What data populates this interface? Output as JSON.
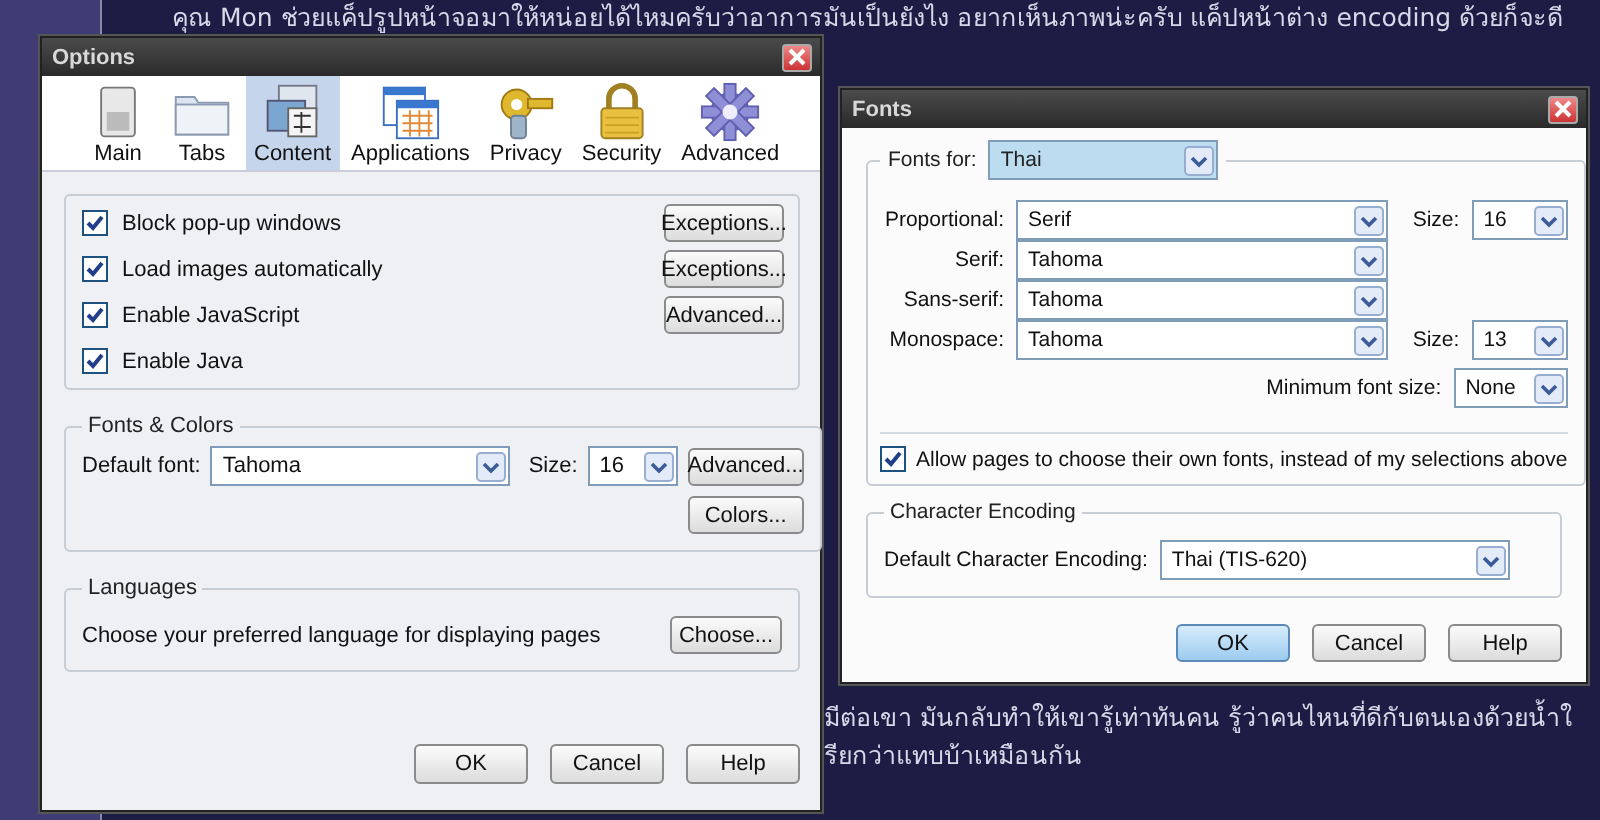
{
  "page_text": {
    "top_line": "คุณ Mon ช่วยแค็ปรูปหน้าจอมาให้หน่อยได้ไหมครับว่าอาการมันเป็นยังไง อยากเห็นภาพน่ะครับ แค็ปหน้าต่าง encoding ด้วยก็จะดี",
    "bottom_lines": [
      "มีต่อเขา มันกลับทำให้เขารู้เท่าทันคน รู้ว่าคนไหนที่ดีกับตนเองด้วยน้ำใ",
      "รียกว่าแทบบ้าเหมือนกัน"
    ]
  },
  "options_window": {
    "title": "Options",
    "tabs": [
      {
        "label": "Main",
        "selected": false
      },
      {
        "label": "Tabs",
        "selected": false
      },
      {
        "label": "Content",
        "selected": true
      },
      {
        "label": "Applications",
        "selected": false
      },
      {
        "label": "Privacy",
        "selected": false
      },
      {
        "label": "Security",
        "selected": false
      },
      {
        "label": "Advanced",
        "selected": false
      }
    ],
    "content_options": [
      {
        "label": "Block pop-up windows",
        "checked": true,
        "button": "Exceptions..."
      },
      {
        "label": "Load images automatically",
        "checked": true,
        "button": "Exceptions..."
      },
      {
        "label": "Enable JavaScript",
        "checked": true,
        "button": "Advanced..."
      },
      {
        "label": "Enable Java",
        "checked": true
      }
    ],
    "fonts_colors": {
      "title": "Fonts & Colors",
      "default_font_label": "Default font:",
      "default_font": "Tahoma",
      "size_label": "Size:",
      "size": "16",
      "advanced_button": "Advanced...",
      "colors_button": "Colors..."
    },
    "languages": {
      "title": "Languages",
      "description": "Choose your preferred language for displaying pages",
      "button": "Choose..."
    },
    "buttons": [
      "OK",
      "Cancel",
      "Help"
    ]
  },
  "fonts_window": {
    "title": "Fonts",
    "fonts_for_label": "Fonts for:",
    "fonts_for": "Thai",
    "rows": [
      {
        "label": "Proportional:",
        "font": "Serif",
        "size_label": "Size:",
        "size": "16"
      },
      {
        "label": "Serif:",
        "font": "Tahoma"
      },
      {
        "label": "Sans-serif:",
        "font": "Tahoma"
      },
      {
        "label": "Monospace:",
        "font": "Tahoma",
        "size_label": "Size:",
        "size": "13"
      }
    ],
    "minimum_label": "Minimum font size:",
    "minimum": "None",
    "allow_pages": {
      "label": "Allow pages to choose their own fonts, instead of my selections above",
      "checked": true
    },
    "encoding": {
      "title": "Character Encoding",
      "label": "Default Character Encoding:",
      "value": "Thai (TIS-620)"
    },
    "buttons": [
      "OK",
      "Cancel",
      "Help"
    ]
  }
}
